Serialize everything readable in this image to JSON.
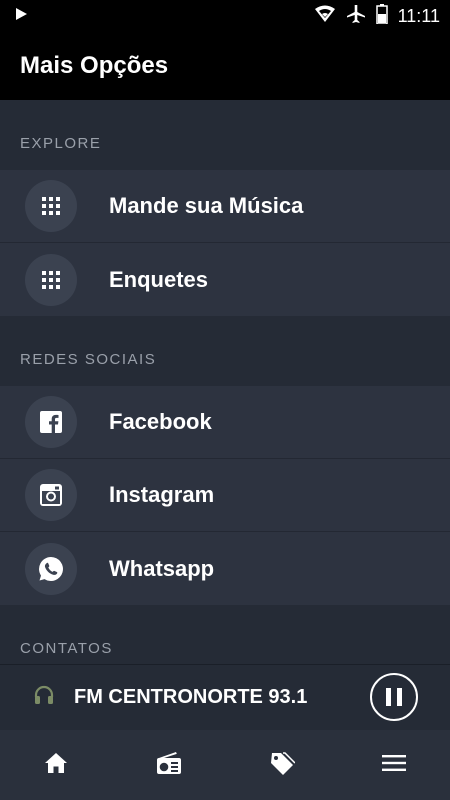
{
  "status_bar": {
    "time": "11:11",
    "icons": [
      "play-indicator-icon",
      "wifi-icon",
      "airplane-icon",
      "battery-icon"
    ]
  },
  "app_bar": {
    "title": "Mais Opções"
  },
  "sections": [
    {
      "header": "EXPLORE",
      "items": [
        {
          "label": "Mande sua Música",
          "icon": "grid-icon"
        },
        {
          "label": "Enquetes",
          "icon": "grid-icon"
        }
      ]
    },
    {
      "header": "REDES SOCIAIS",
      "items": [
        {
          "label": "Facebook",
          "icon": "facebook-icon"
        },
        {
          "label": "Instagram",
          "icon": "instagram-icon"
        },
        {
          "label": "Whatsapp",
          "icon": "whatsapp-icon"
        }
      ]
    },
    {
      "header": "CONTATOS",
      "items": []
    }
  ],
  "player": {
    "station": "FM CENTRONORTE 93.1",
    "state": "playing",
    "icon": "headphones-icon"
  },
  "bottom_nav": {
    "items": [
      "home-icon",
      "radio-icon",
      "tag-icon",
      "menu-icon"
    ]
  },
  "colors": {
    "background": "#252b36",
    "item_background": "#2d3340",
    "icon_circle": "#3b4250",
    "header_text": "#9aa0aa",
    "bar_black": "#000000"
  }
}
